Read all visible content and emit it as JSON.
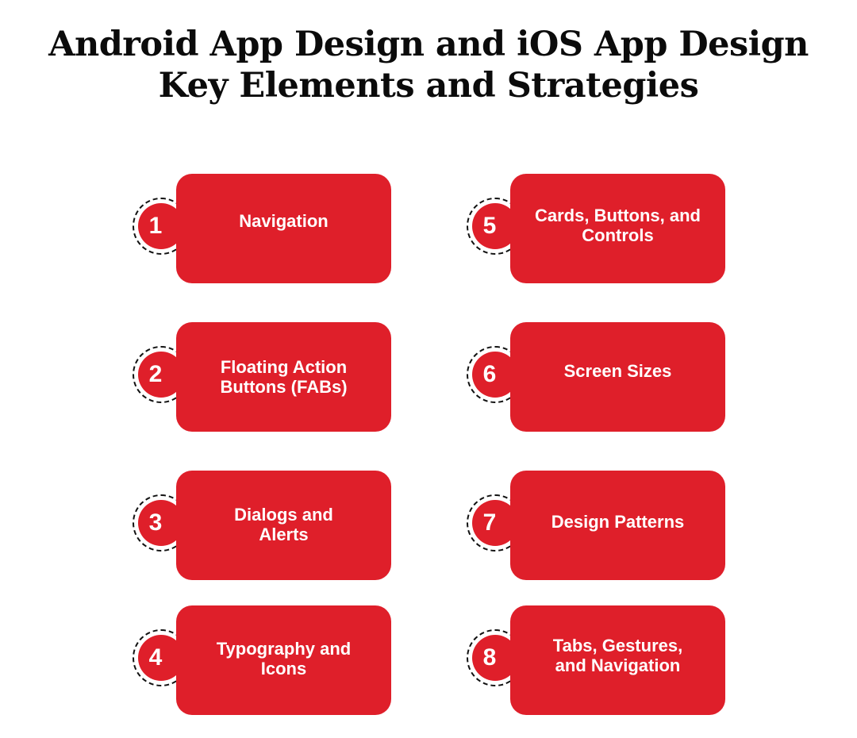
{
  "title": {
    "line1": "Android App Design and iOS App Design",
    "line2": "Key Elements and Strategies"
  },
  "colors": {
    "accent": "#df1f2a",
    "text": "#0b0b0b",
    "card_text": "#ffffff"
  },
  "items": [
    {
      "number": "1",
      "label": "Navigation"
    },
    {
      "number": "2",
      "label": "Floating Action Buttons (FABs)"
    },
    {
      "number": "3",
      "label": "Dialogs and Alerts"
    },
    {
      "number": "4",
      "label": "Typography and Icons"
    },
    {
      "number": "5",
      "label": "Cards, Buttons, and Controls"
    },
    {
      "number": "6",
      "label": "Screen Sizes"
    },
    {
      "number": "7",
      "label": "Design Patterns"
    },
    {
      "number": "8",
      "label": "Tabs, Gestures, and Navigation"
    }
  ]
}
